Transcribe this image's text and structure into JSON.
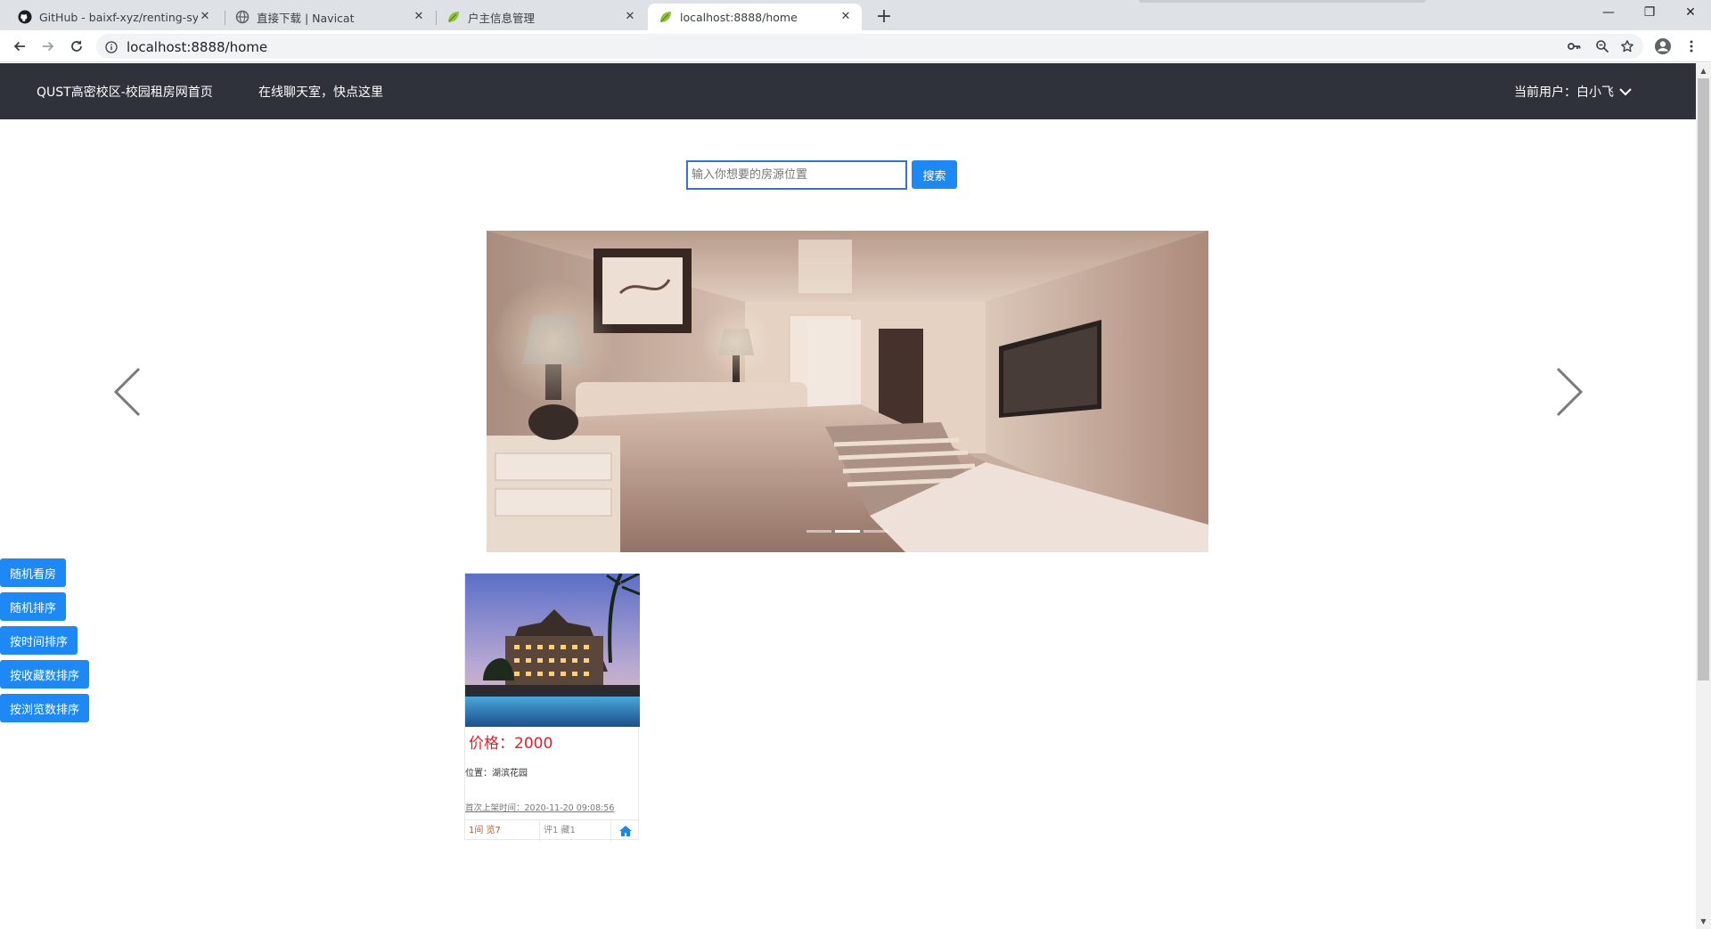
{
  "browser": {
    "tabs": [
      {
        "title": "GitHub - baixf-xyz/renting-sys",
        "icon": "github-icon"
      },
      {
        "title": "直接下载 | Navicat",
        "icon": "globe-icon"
      },
      {
        "title": "户主信息管理",
        "icon": "leaf-icon"
      },
      {
        "title": "localhost:8888/home",
        "icon": "leaf-icon"
      }
    ],
    "url": "localhost:8888/home"
  },
  "navbar": {
    "home_link": "QUST高密校区-校园租房网首页",
    "chat_link": "在线聊天室，快点这里",
    "user_label": "当前用户：白小飞"
  },
  "search": {
    "placeholder": "输入你想要的房源位置",
    "button_label": "搜索"
  },
  "carousel": {
    "slide_count": 3,
    "active_index": 1
  },
  "sort_buttons": [
    "随机看房",
    "随机排序",
    "按时间排序",
    "按收藏数排序",
    "按浏览数排序"
  ],
  "listing": {
    "price": "价格：2000",
    "location": "位置：湖滨花园",
    "first_listed": "首次上架时间：2020-11-20 09:08:56",
    "stat_rooms_views": "1间 览7",
    "stat_comments_favs": "评1 藏1"
  },
  "colors": {
    "navbar_bg": "#2f323b",
    "button_blue": "#1e88f5",
    "price_red": "#e0202c"
  }
}
